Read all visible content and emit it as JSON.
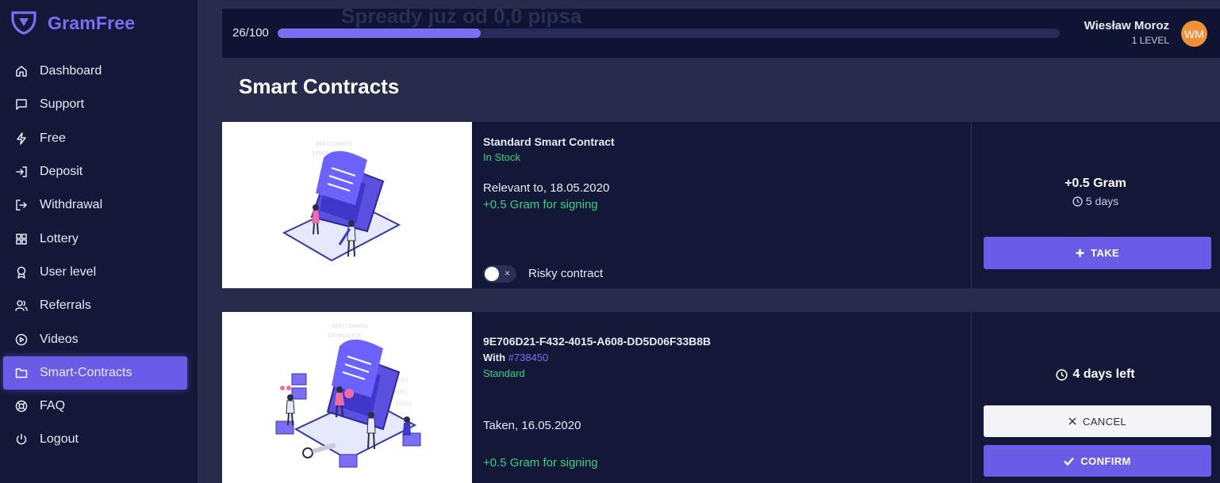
{
  "app": {
    "brand": "GramFree",
    "colors": {
      "accent": "#6b5ce7",
      "success": "#3ad17f",
      "avatar": "#f0913a"
    }
  },
  "sidebar": {
    "items": [
      {
        "label": "Dashboard",
        "icon": "home-icon"
      },
      {
        "label": "Support",
        "icon": "chat-icon"
      },
      {
        "label": "Free",
        "icon": "lightning-icon"
      },
      {
        "label": "Deposit",
        "icon": "login-icon"
      },
      {
        "label": "Withdrawal",
        "icon": "logout-arrow-icon"
      },
      {
        "label": "Lottery",
        "icon": "grid-icon"
      },
      {
        "label": "User level",
        "icon": "award-icon"
      },
      {
        "label": "Referrals",
        "icon": "users-icon"
      },
      {
        "label": "Videos",
        "icon": "play-circle-icon"
      },
      {
        "label": "Smart-Contracts",
        "icon": "folder-icon",
        "active": true
      },
      {
        "label": "FAQ",
        "icon": "lifebuoy-icon"
      },
      {
        "label": "Logout",
        "icon": "power-icon"
      }
    ]
  },
  "topbar": {
    "background_text": "Spready już od 0,0 pipsa",
    "progress_label": "26/100",
    "progress_value": 0.26,
    "user_name": "Wiesław Moroz",
    "user_level": "1 LEVEL",
    "avatar_initials": "WM"
  },
  "page": {
    "title": "Smart Contracts"
  },
  "contracts": [
    {
      "title": "Standard Smart Contract",
      "status": "In Stock",
      "relevant": "Relevant to, 18.05.2020",
      "reward": "+0.5 Gram for signing",
      "risky_label": "Risky contract",
      "toggle_x": "×",
      "amount": "+0.5 Gram",
      "duration": "5 days",
      "take_label": "TAKE"
    },
    {
      "id": "9E706D21-F432-4015-A608-DD5D06F33B8B",
      "with_label": "With",
      "with_ref": "#738450",
      "type": "Standard",
      "taken": "Taken, 16.05.2020",
      "reward": "+0.5 Gram for signing",
      "time_left": "4 days left",
      "cancel_label": "CANCEL",
      "confirm_label": "CONFIRM"
    }
  ]
}
